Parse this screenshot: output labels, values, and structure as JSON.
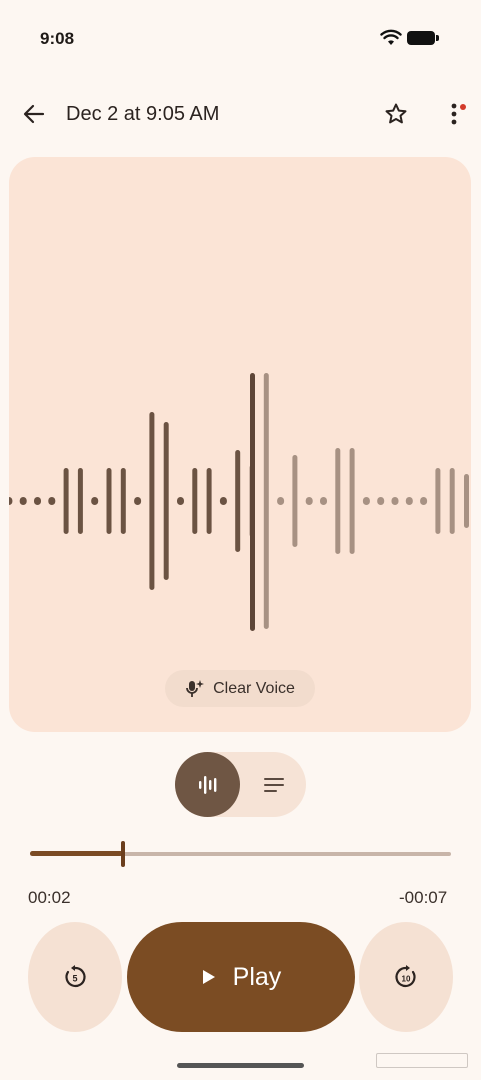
{
  "status_bar": {
    "time": "9:08"
  },
  "top_bar": {
    "title": "Dec 2 at 9:05 AM"
  },
  "waveform": {
    "played_fraction": 0.5,
    "clear_voice_label": "Clear Voice"
  },
  "playback": {
    "elapsed": "00:02",
    "remaining": "-00:07",
    "progress_fraction": 0.22,
    "play_label": "Play",
    "rewind_seconds": "5",
    "forward_seconds": "10"
  },
  "colors": {
    "background": "#fdf7f2",
    "card": "#fbe4d6",
    "accent": "#7b4c23",
    "played_bar": "#6b5343",
    "unplayed_bar": "#a79183"
  }
}
